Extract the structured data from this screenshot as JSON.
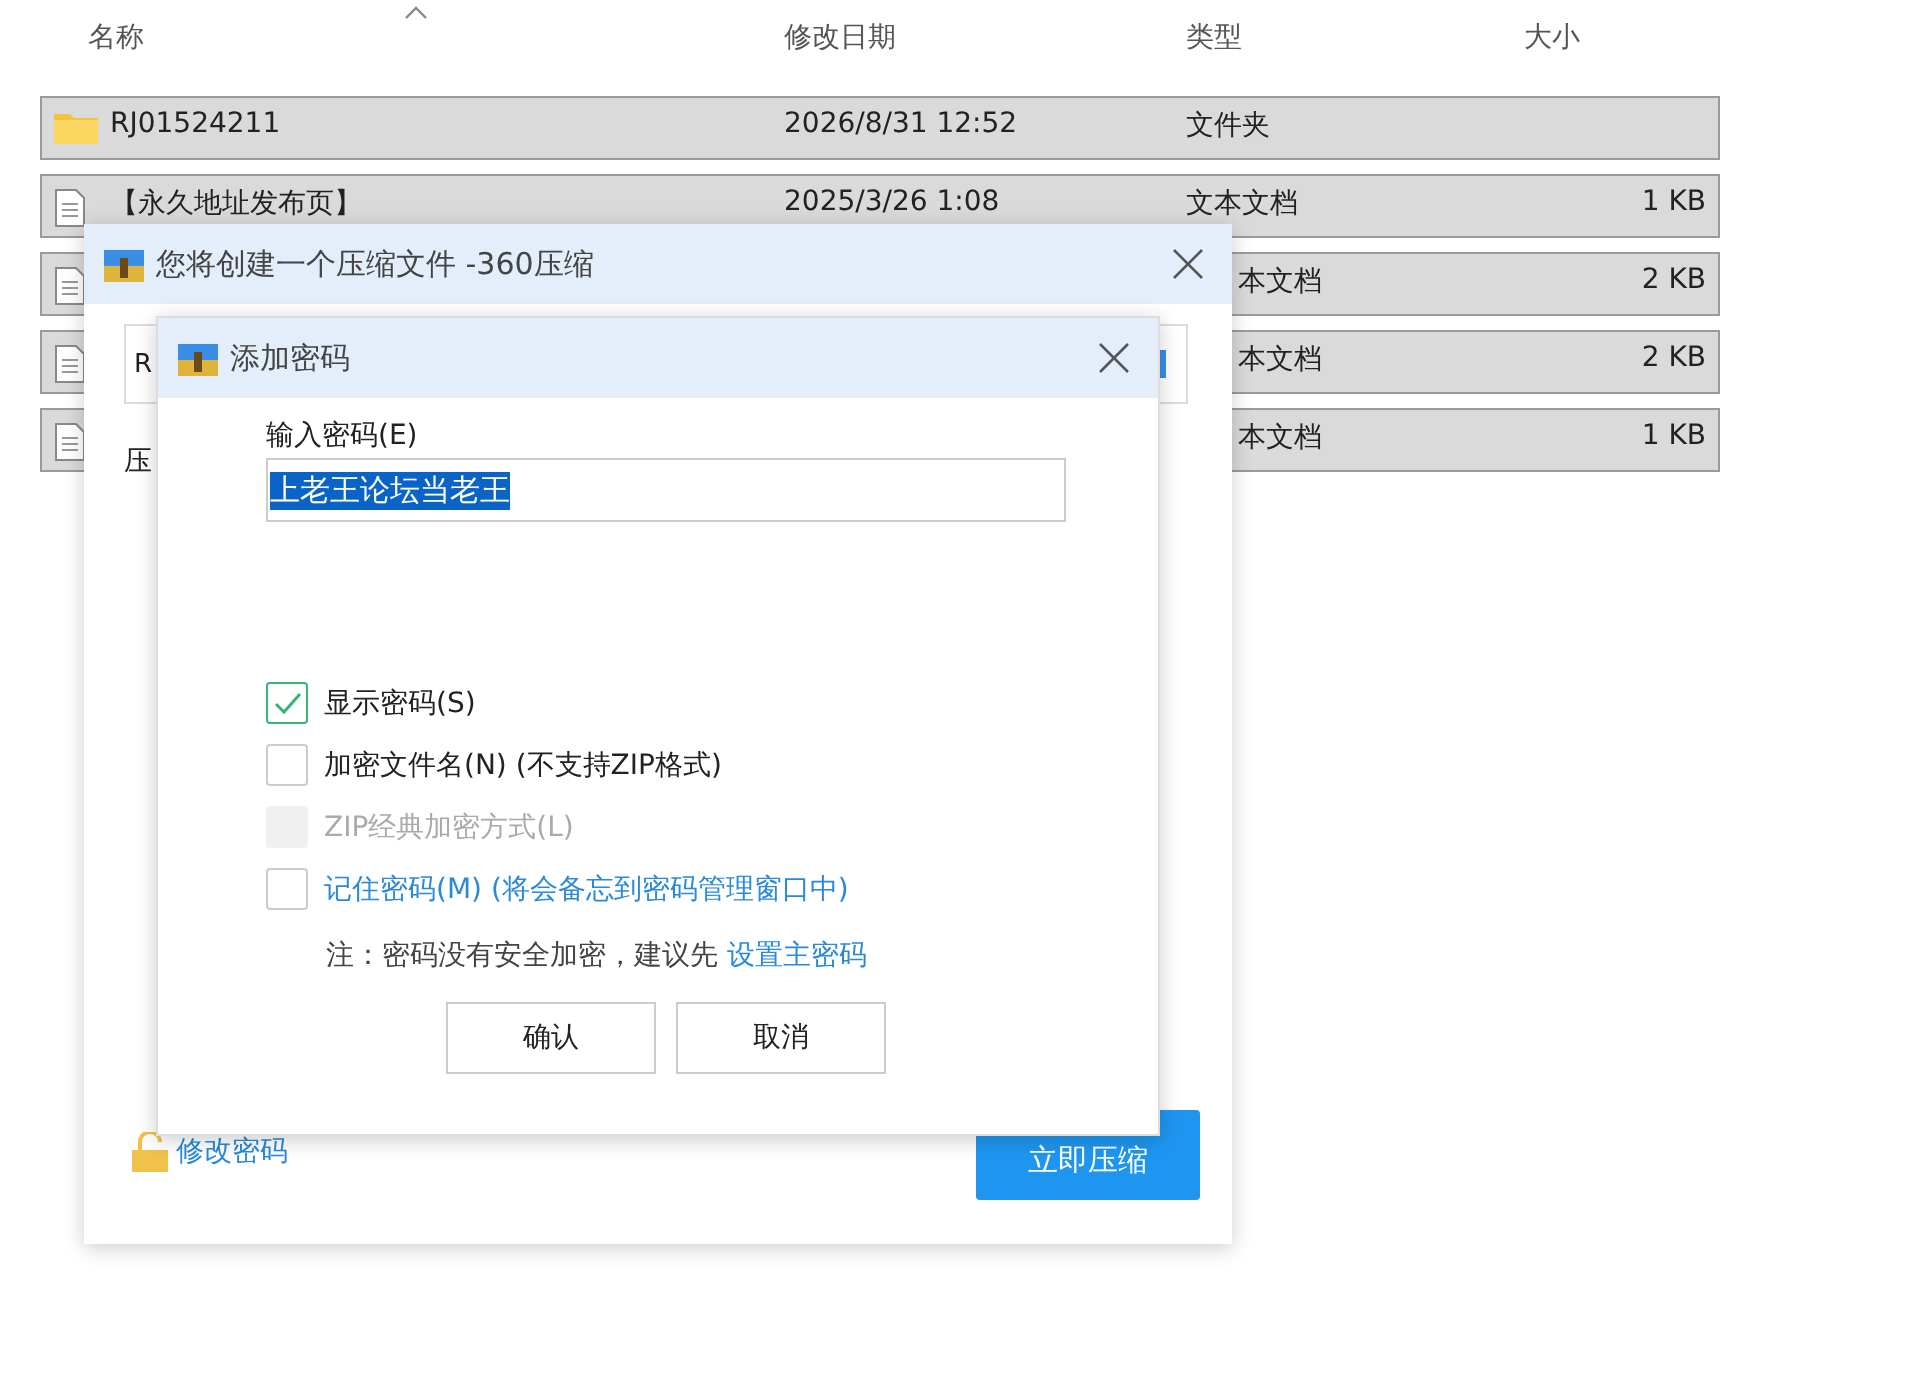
{
  "explorer": {
    "columns": [
      "名称",
      "修改日期",
      "类型",
      "大小"
    ],
    "rows": [
      {
        "kind": "folder",
        "name": "RJ01524211",
        "date": "2026/8/31 12:52",
        "type": "文件夹",
        "selected": true
      },
      {
        "kind": "text",
        "name": "【永久地址发布页】",
        "date": "2025/3/26 1:08",
        "type": "文本文档",
        "size": "1 KB",
        "selected": true
      },
      {
        "kind": "text",
        "type": "本文档",
        "size": "2 KB",
        "selected": true
      },
      {
        "kind": "text",
        "type": "本文档",
        "size": "2 KB",
        "selected": true
      },
      {
        "kind": "text",
        "type": "本文档",
        "size": "1 KB",
        "selected": true
      }
    ]
  },
  "compress_window": {
    "title": "您将创建一个压缩文件 -360压缩",
    "path_value": "R",
    "label": "压",
    "change_password_link": "修改密码",
    "compress_button": "立即压缩"
  },
  "password_dialog": {
    "title": "添加密码",
    "field_label": "输入密码(E)",
    "password_value": "上老王论坛当老王",
    "options": [
      {
        "kind": "plain",
        "label": "显示密码(S)",
        "checked": true,
        "disabled": false
      },
      {
        "kind": "plain",
        "label": "加密文件名(N) (不支持ZIP格式)",
        "checked": false,
        "disabled": false
      },
      {
        "kind": "plain",
        "label": "ZIP经典加密方式(L)",
        "checked": false,
        "disabled": true
      },
      {
        "kind": "link",
        "label": "记住密码(M) (将会备忘到密码管理窗口中)",
        "checked": false,
        "disabled": false
      }
    ],
    "note": "注：密码没有安全加密，建议先",
    "note_link": "设置主密码",
    "buttons": [
      "确认",
      "取消"
    ]
  }
}
